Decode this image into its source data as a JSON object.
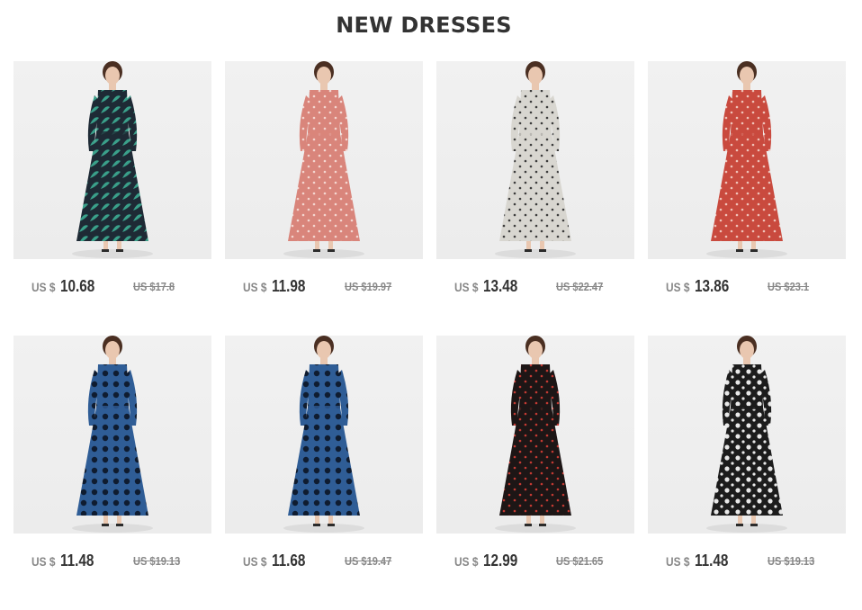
{
  "section": {
    "title": "NEW DRESSES"
  },
  "currency_label": "US $",
  "products": [
    {
      "price": "10.68",
      "old_price": "US $17.8",
      "dress_color": "#1e2a35",
      "pattern_color": "#3aa08a",
      "pattern": "leaf"
    },
    {
      "price": "11.98",
      "old_price": "US $19.97",
      "dress_color": "#d9857b",
      "pattern_color": "#f4d6d0",
      "pattern": "dot"
    },
    {
      "price": "13.48",
      "old_price": "US $22.47",
      "dress_color": "#d8d6d0",
      "pattern_color": "#3b3b3b",
      "pattern": "dot"
    },
    {
      "price": "13.86",
      "old_price": "US $23.1",
      "dress_color": "#c94a3e",
      "pattern_color": "#f0c2b8",
      "pattern": "dot"
    },
    {
      "price": "11.48",
      "old_price": "US $19.13",
      "dress_color": "#2f5d96",
      "pattern_color": "#0f1c30",
      "pattern": "bigdot"
    },
    {
      "price": "11.68",
      "old_price": "US $19.47",
      "dress_color": "#2f5d96",
      "pattern_color": "#0f1c30",
      "pattern": "bigdot"
    },
    {
      "price": "12.99",
      "old_price": "US $21.65",
      "dress_color": "#1d1616",
      "pattern_color": "#c43a33",
      "pattern": "dot"
    },
    {
      "price": "11.48",
      "old_price": "US $19.13",
      "dress_color": "#1c1c1c",
      "pattern_color": "#e8e8e8",
      "pattern": "flower"
    }
  ]
}
